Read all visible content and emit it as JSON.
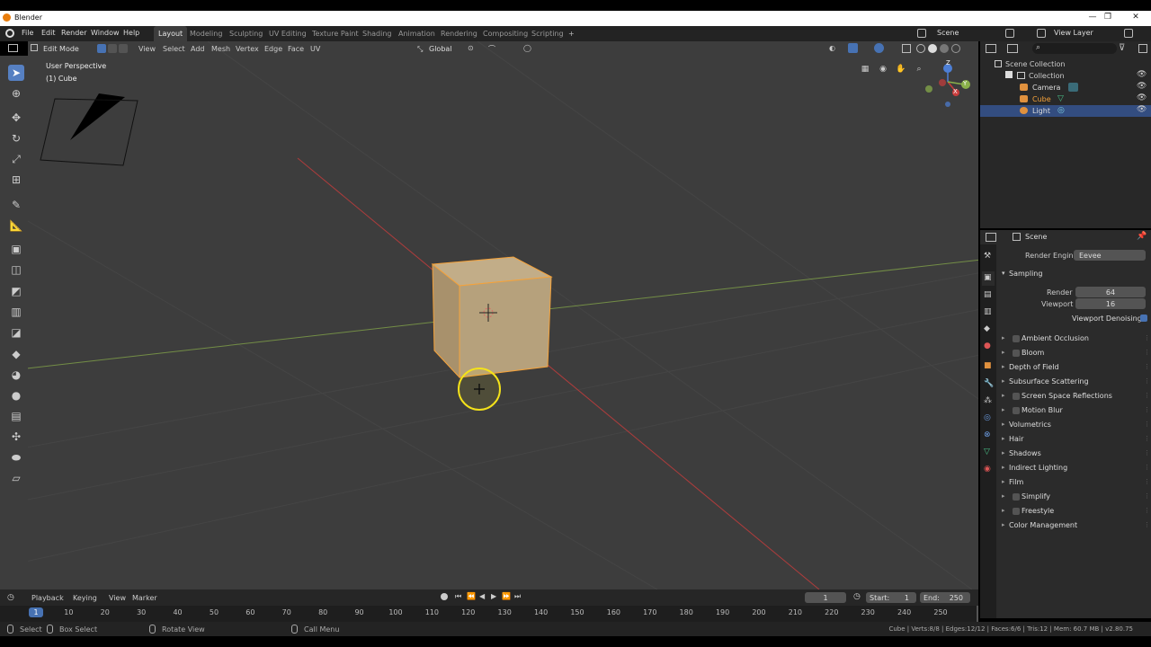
{
  "window": {
    "title": "Blender",
    "controls": [
      "—",
      "❐",
      "✕"
    ]
  },
  "menubar": {
    "menus": [
      "File",
      "Edit",
      "Render",
      "Window",
      "Help"
    ],
    "workspaces": [
      "Layout",
      "Modeling",
      "Sculpting",
      "UV Editing",
      "Texture Paint",
      "Shading",
      "Animation",
      "Rendering",
      "Compositing",
      "Scripting"
    ],
    "active_workspace": "Layout",
    "add_workspace": "+",
    "scene": "Scene",
    "view_layer": "View Layer"
  },
  "viewport_header": {
    "mode": "Edit Mode",
    "menus": [
      "View",
      "Select",
      "Add",
      "Mesh",
      "Vertex",
      "Edge",
      "Face",
      "UV"
    ],
    "transform_orientation": "Global"
  },
  "viewport": {
    "perspective_label": "User Perspective",
    "object_label": "(1) Cube",
    "gizmo": {
      "z": "Z",
      "y": "Y",
      "x": "X"
    }
  },
  "toolbar": {
    "tools": [
      "select-box",
      "cursor",
      "move",
      "rotate",
      "scale",
      "transform",
      "annotate",
      "measure",
      "add-cube",
      "extrude",
      "inset",
      "bevel",
      "loop-cut",
      "knife",
      "poly-build",
      "spin",
      "smooth",
      "edge-slide",
      "shrink-fatten",
      "shear",
      "rip"
    ],
    "active": "select-box"
  },
  "outliner": {
    "root": "Scene Collection",
    "items": [
      {
        "label": "Collection",
        "icon": "collection-icon"
      },
      {
        "label": "Camera",
        "icon": "camera-icon"
      },
      {
        "label": "Cube",
        "icon": "mesh-icon"
      },
      {
        "label": "Light",
        "icon": "light-icon"
      }
    ],
    "selected": "Light"
  },
  "properties": {
    "context": "Scene",
    "render_engine_label": "Render Engine",
    "render_engine": "Eevee",
    "sampling": {
      "label": "Sampling",
      "render_label": "Render",
      "render": "64",
      "viewport_label": "Viewport",
      "viewport": "16",
      "denoise_label": "Viewport Denoising",
      "denoise": true
    },
    "panels": [
      {
        "label": "Ambient Occlusion",
        "checkbox": true
      },
      {
        "label": "Bloom",
        "checkbox": true
      },
      {
        "label": "Depth of Field",
        "checkbox": false
      },
      {
        "label": "Subsurface Scattering",
        "checkbox": false
      },
      {
        "label": "Screen Space Reflections",
        "checkbox": true
      },
      {
        "label": "Motion Blur",
        "checkbox": true
      },
      {
        "label": "Volumetrics",
        "checkbox": false
      },
      {
        "label": "Hair",
        "checkbox": false
      },
      {
        "label": "Shadows",
        "checkbox": false
      },
      {
        "label": "Indirect Lighting",
        "checkbox": false
      },
      {
        "label": "Film",
        "checkbox": false
      },
      {
        "label": "Simplify",
        "checkbox": true
      },
      {
        "label": "Freestyle",
        "checkbox": true
      },
      {
        "label": "Color Management",
        "checkbox": false
      }
    ]
  },
  "timeline": {
    "menus": [
      "Playback",
      "Keying",
      "View",
      "Marker"
    ],
    "current_frame": "1",
    "start_label": "Start:",
    "start": "1",
    "end_label": "End:",
    "end": "250",
    "ticks": [
      "1",
      "10",
      "20",
      "30",
      "40",
      "50",
      "60",
      "70",
      "80",
      "90",
      "100",
      "110",
      "120",
      "130",
      "140",
      "150",
      "160",
      "170",
      "180",
      "190",
      "200",
      "210",
      "220",
      "230",
      "240",
      "250"
    ]
  },
  "statusbar": {
    "select": "Select",
    "box_select": "Box Select",
    "rotate_view": "Rotate View",
    "call_menu": "Call Menu",
    "stats": "Cube | Verts:8/8 | Edges:12/12 | Faces:6/6 | Tris:12 | Mem: 60.7 MB | v2.80.75"
  },
  "colors": {
    "accent": "#4772b3",
    "selection": "#334d80",
    "x_axis": "#c93c3c",
    "y_axis": "#8ab04a",
    "cube_face": "#b6a17c",
    "cube_edge": "#f5a23a",
    "cursor_ring": "#f4e21a"
  }
}
